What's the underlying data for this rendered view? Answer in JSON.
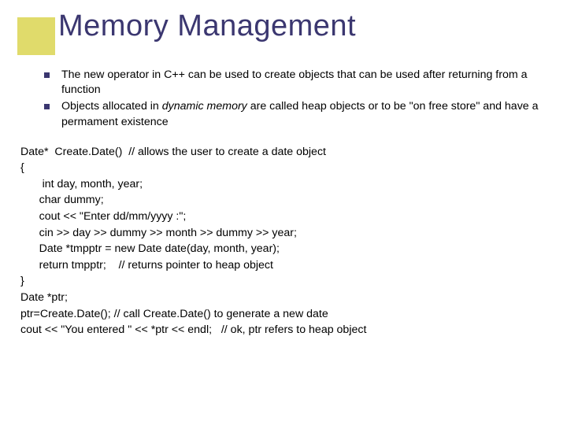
{
  "title": "Memory Management",
  "bullets": [
    {
      "pre": "The new operator in C++ can be used to create objects that can be used after returning from a function",
      "italic": "",
      "post": ""
    },
    {
      "pre": "Objects allocated in ",
      "italic": "dynamic memory",
      "post": " are called  heap objects or to be \"on free store\" and have a permament existence"
    }
  ],
  "code": {
    "l1": "Date*  Create.Date()  // allows the user to create a date object",
    "l2": "{",
    "l3": "       int day, month, year;",
    "l4": "      char dummy;",
    "l5": "      cout << \"Enter dd/mm/yyyy :\";",
    "l6": "      cin >> day >> dummy >> month >> dummy >> year;",
    "l7": "      Date *tmpptr = new Date date(day, month, year);",
    "l8": "      return tmpptr;    // returns pointer to heap object",
    "l9": "}",
    "l10": "Date *ptr;",
    "l11": "ptr=Create.Date(); // call Create.Date() to generate a new date",
    "l12": "cout << \"You entered \" << *ptr << endl;   // ok, ptr refers to heap object"
  }
}
